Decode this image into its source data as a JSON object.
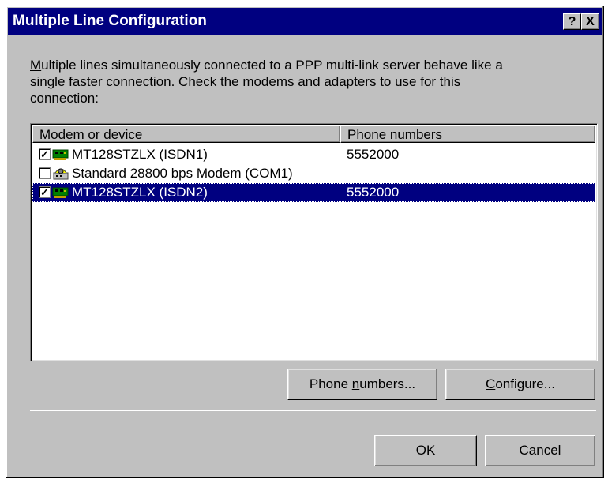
{
  "window": {
    "title": "Multiple Line Configuration",
    "help_label": "?",
    "close_label": "X"
  },
  "description": {
    "line1_accel": "M",
    "line1_rest": "ultiple lines simultaneously connected to a PPP multi-link server behave like a",
    "line2": "single faster connection.  Check the modems and adapters to use for this",
    "line3": "connection:"
  },
  "list": {
    "columns": [
      "Modem or device",
      "Phone numbers"
    ],
    "rows": [
      {
        "checked": "✓",
        "icon": "isdn-adapter-icon",
        "name": "MT128STZLX (ISDN1)",
        "phone": "5552000",
        "selected": false
      },
      {
        "checked": "",
        "icon": "modem-icon",
        "name": "Standard 28800 bps Modem (COM1)",
        "phone": "",
        "selected": false
      },
      {
        "checked": "✓",
        "icon": "isdn-adapter-icon",
        "name": "MT128STZLX (ISDN2)",
        "phone": "5552000",
        "selected": true
      }
    ]
  },
  "buttons": {
    "phone_numbers_pre": "Phone ",
    "phone_numbers_accel": "n",
    "phone_numbers_post": "umbers...",
    "configure_accel": "C",
    "configure_post": "onfigure...",
    "ok": "OK",
    "cancel": "Cancel"
  },
  "colors": {
    "titlebar": "#000080",
    "selection": "#000080",
    "face": "#c0c0c0"
  }
}
